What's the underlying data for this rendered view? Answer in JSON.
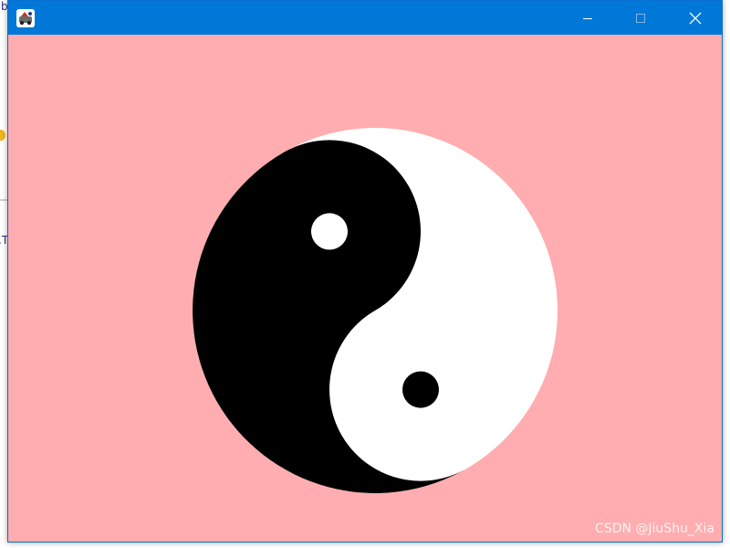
{
  "background": {
    "glyphs": [
      "b",
      ".T"
    ]
  },
  "window": {
    "title_text": "",
    "titlebar_color": "#0078d7",
    "background_color": "#ffadb0",
    "buttons": {
      "minimize_icon": "minimize-icon",
      "maximize_icon": "maximize-icon",
      "close_icon": "close-icon"
    }
  },
  "taiji": {
    "dark_color": "#000000",
    "light_color": "#ffffff"
  },
  "watermark": {
    "text": "CSDN @JiuShu_Xia"
  }
}
